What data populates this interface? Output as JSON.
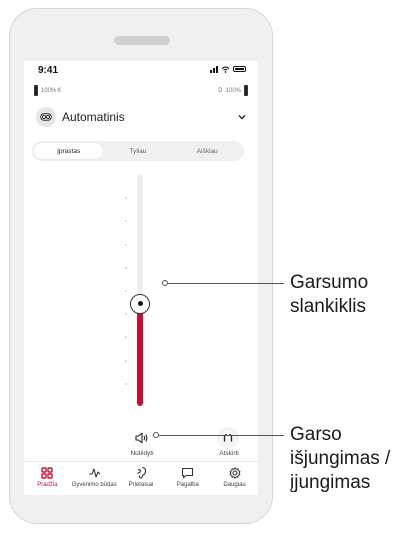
{
  "status": {
    "time": "9:41"
  },
  "hearing_aids": {
    "left_label": "100%",
    "left_side": "K",
    "right_side": "D",
    "right_label": "100%"
  },
  "program": {
    "label": "Automatinis"
  },
  "segments": [
    "Įprastas",
    "Tyliau",
    "Aiškiau"
  ],
  "active_segment": 0,
  "volume": {
    "level": 0.44,
    "tick_count": 10
  },
  "controls": {
    "mute_label": "Nutildyti",
    "separate_label": "Atskirti"
  },
  "nav": [
    {
      "label": "Pradžia",
      "icon": "grid-icon",
      "active": true
    },
    {
      "label": "Gyvenimo būdas",
      "icon": "activity-icon",
      "active": false
    },
    {
      "label": "Prietaisai",
      "icon": "hearing-aid-icon",
      "active": false
    },
    {
      "label": "Pagalba",
      "icon": "chat-icon",
      "active": false
    },
    {
      "label": "Daugiau",
      "icon": "gear-icon",
      "active": false
    }
  ],
  "colors": {
    "accent": "#c8102e"
  },
  "callouts": {
    "slider_line1": "Garsumo",
    "slider_line2": "slankiklis",
    "mute_line1": "Garso",
    "mute_line2": "išjungimas /",
    "mute_line3": "įjungimas"
  }
}
